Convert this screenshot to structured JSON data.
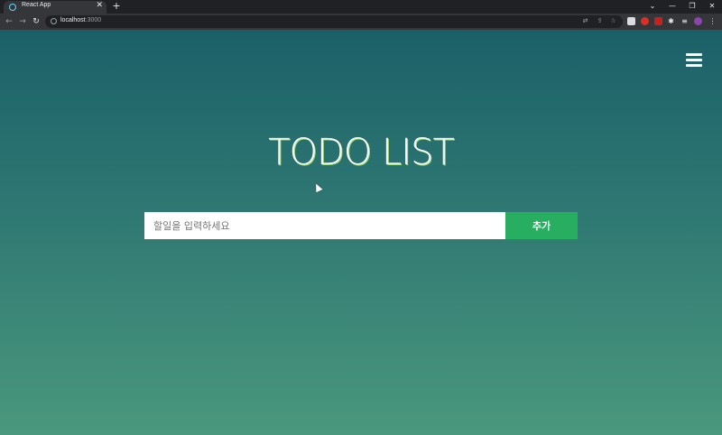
{
  "browser": {
    "tab_title": "React App",
    "tab_close": "✕",
    "new_tab": "+",
    "url_host": "localhost",
    "url_port": ":3000",
    "window_controls": [
      "⌄",
      "—",
      "❐",
      "✕"
    ]
  },
  "app": {
    "title": "TODO LIST",
    "input_placeholder": "할일을 입력하세요",
    "input_value": "",
    "add_button_label": "추가"
  },
  "colors": {
    "gradient_top": "#1b6068",
    "gradient_bottom": "#4a987d",
    "button": "#27ae60",
    "title_shadow": "#9be07f"
  },
  "icons": {
    "menu": "hamburger-menu-icon",
    "favicon": "react-icon"
  }
}
